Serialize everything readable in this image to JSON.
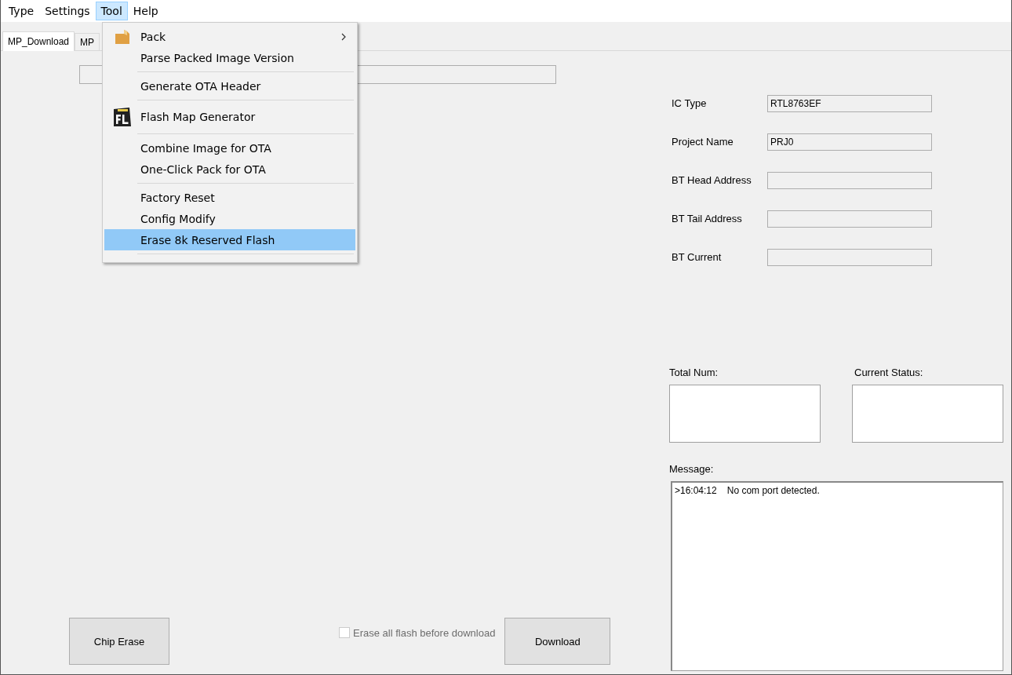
{
  "menu_bar": [
    {
      "label": "Type",
      "selected": false
    },
    {
      "label": "Settings",
      "selected": false
    },
    {
      "label": "Tool",
      "selected": true
    },
    {
      "label": "Help",
      "selected": false
    }
  ],
  "tool_menu": {
    "groups": [
      [
        {
          "label": "Pack",
          "kind": "package",
          "submenu": true,
          "selected": false
        },
        {
          "label": "Parse Packed Image Version",
          "kind": "plain",
          "selected": false
        }
      ],
      [
        {
          "label": "Generate OTA Header",
          "kind": "plain",
          "selected": false
        }
      ],
      [
        {
          "label": "Flash Map Generator",
          "kind": "flashmap",
          "selected": false
        }
      ],
      [
        {
          "label": "Combine Image for OTA",
          "kind": "plain",
          "selected": false
        },
        {
          "label": "One-Click Pack for OTA",
          "kind": "plain",
          "selected": false
        }
      ],
      [
        {
          "label": "Factory Reset",
          "kind": "plain",
          "selected": false
        },
        {
          "label": "Config Modify",
          "kind": "plain",
          "selected": false
        },
        {
          "label": "Erase 8k Reserved Flash",
          "kind": "plain",
          "selected": true
        }
      ]
    ]
  },
  "tabs": [
    {
      "label": "MP_Download",
      "selected": true
    },
    {
      "label": "MP",
      "selected": false
    }
  ],
  "info_fields": [
    {
      "label": "IC Type",
      "value": "RTL8763EF"
    },
    {
      "label": "Project Name",
      "value": "PRJ0"
    },
    {
      "label": "BT Head Address"
    },
    {
      "label": "BT Tail Address"
    },
    {
      "label": "BT Current"
    }
  ],
  "total_num": {
    "label": "Total Num:"
  },
  "current_status": {
    "label": "Current Status:"
  },
  "message": {
    "label": "Message:",
    "lines": [
      {
        "time": ">16:04:12",
        "text": "No com port detected."
      }
    ]
  },
  "chip_erase_button": "Chip Erase",
  "erase_all_checkbox": {
    "label": "Erase all flash before download",
    "checked": false,
    "disabled": true
  },
  "download_button": "Download"
}
